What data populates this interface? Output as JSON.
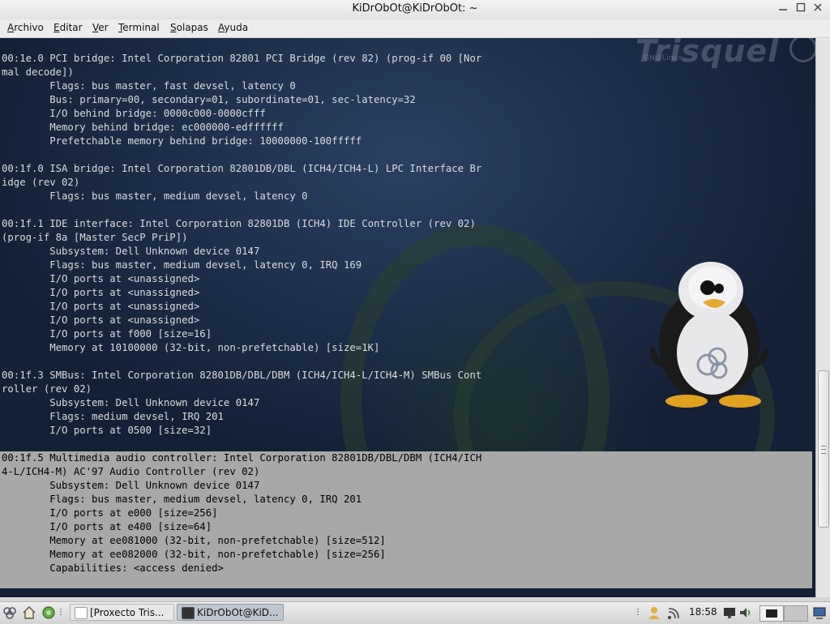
{
  "window": {
    "title": "KiDrObOt@KiDrObOt: ~"
  },
  "menu": [
    {
      "mnemonic": "A",
      "rest": "rchivo"
    },
    {
      "mnemonic": "E",
      "rest": "ditar"
    },
    {
      "mnemonic": "V",
      "rest": "er"
    },
    {
      "mnemonic": "T",
      "rest": "erminal"
    },
    {
      "mnemonic": "S",
      "rest": "olapas"
    },
    {
      "mnemonic": "A",
      "rest": "yuda"
    }
  ],
  "wallpaper": {
    "logo": "Trisquel",
    "sub": "GNU/Linux"
  },
  "terminal": {
    "lines": [
      "00:1e.0 PCI bridge: Intel Corporation 82801 PCI Bridge (rev 82) (prog-if 00 [Nor",
      "mal decode])",
      "        Flags: bus master, fast devsel, latency 0",
      "        Bus: primary=00, secondary=01, subordinate=01, sec-latency=32",
      "        I/O behind bridge: 0000c000-0000cfff",
      "        Memory behind bridge: ec000000-edffffff",
      "        Prefetchable memory behind bridge: 10000000-100fffff",
      "",
      "00:1f.0 ISA bridge: Intel Corporation 82801DB/DBL (ICH4/ICH4-L) LPC Interface Br",
      "idge (rev 02)",
      "        Flags: bus master, medium devsel, latency 0",
      "",
      "00:1f.1 IDE interface: Intel Corporation 82801DB (ICH4) IDE Controller (rev 02)",
      "(prog-if 8a [Master SecP PriP])",
      "        Subsystem: Dell Unknown device 0147",
      "        Flags: bus master, medium devsel, latency 0, IRQ 169",
      "        I/O ports at <unassigned>",
      "        I/O ports at <unassigned>",
      "        I/O ports at <unassigned>",
      "        I/O ports at <unassigned>",
      "        I/O ports at f000 [size=16]",
      "        Memory at 10100000 (32-bit, non-prefetchable) [size=1K]",
      "",
      "00:1f.3 SMBus: Intel Corporation 82801DB/DBL/DBM (ICH4/ICH4-L/ICH4-M) SMBus Cont",
      "roller (rev 02)",
      "        Subsystem: Dell Unknown device 0147",
      "        Flags: medium devsel, IRQ 201",
      "        I/O ports at 0500 [size=32]",
      ""
    ],
    "selected_lines": [
      "00:1f.5 Multimedia audio controller: Intel Corporation 82801DB/DBL/DBM (ICH4/ICH",
      "4-L/ICH4-M) AC'97 Audio Controller (rev 02)",
      "        Subsystem: Dell Unknown device 0147",
      "        Flags: bus master, medium devsel, latency 0, IRQ 201",
      "        I/O ports at e000 [size=256]",
      "        I/O ports at e400 [size=64]",
      "        Memory at ee081000 (32-bit, non-prefetchable) [size=512]",
      "        Memory at ee082000 (32-bit, non-prefetchable) [size=256]",
      "        Capabilities: <access denied>"
    ]
  },
  "taskbar": {
    "tasks": [
      {
        "label": "[Proxecto Tris...",
        "active": false
      },
      {
        "label": "KiDrObOt@KiD...",
        "active": true
      }
    ],
    "clock": "18:58"
  },
  "colors": {
    "terminal_text": "#d9dcdf",
    "selection_bg": "#a8a8a8"
  }
}
